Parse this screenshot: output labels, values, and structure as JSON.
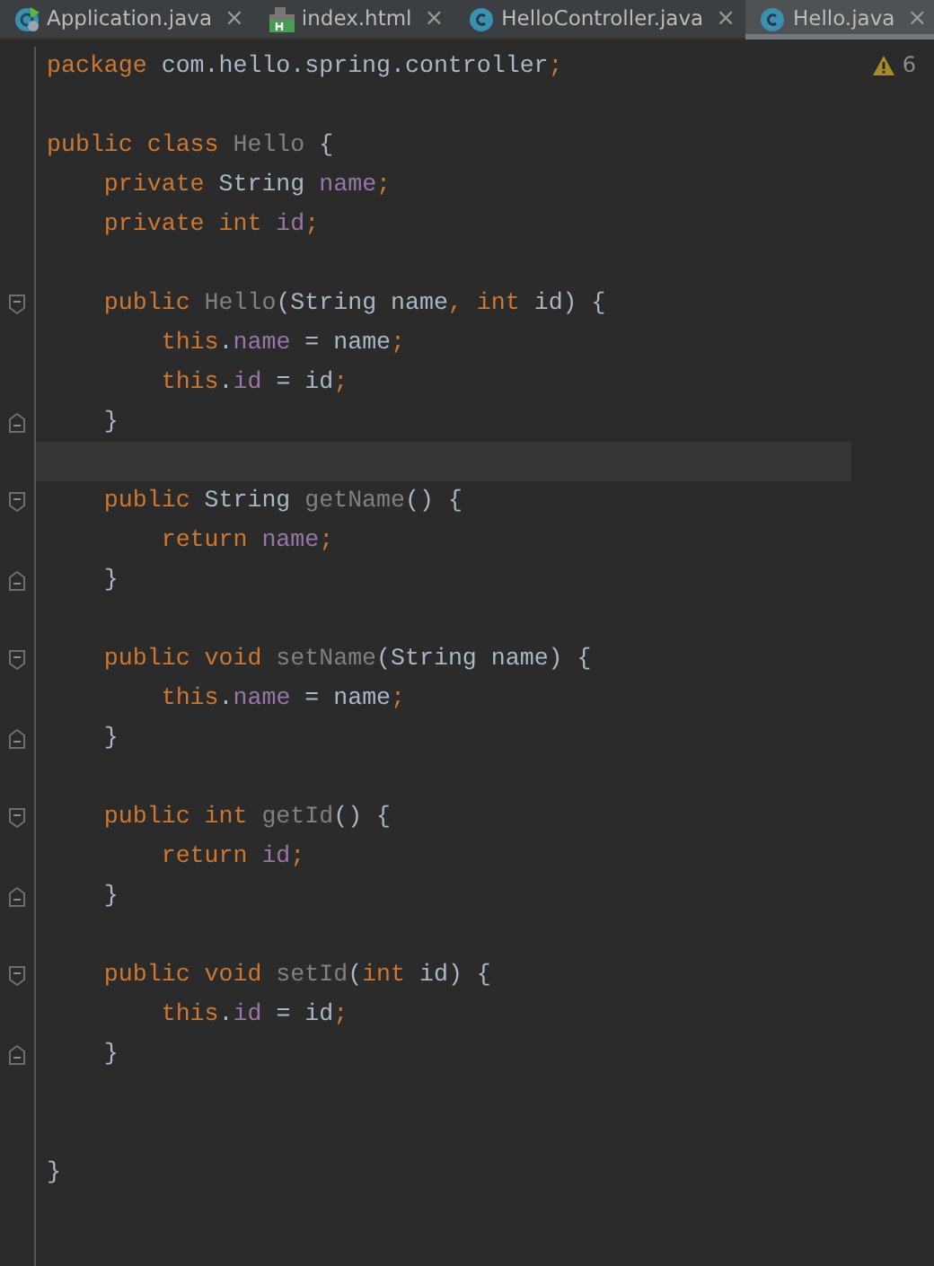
{
  "tabs": [
    {
      "label": "Application.java",
      "kind": "spring",
      "selected": false,
      "close": "×"
    },
    {
      "label": "index.html",
      "kind": "html",
      "selected": false,
      "close": "×"
    },
    {
      "label": "HelloController.java",
      "kind": "class",
      "selected": false,
      "close": "×"
    },
    {
      "label": "Hello.java",
      "kind": "class",
      "selected": true,
      "close": "×"
    }
  ],
  "warnings": {
    "count": "6"
  },
  "lines": [
    {
      "kind": "plain",
      "tokens": [
        {
          "text": "package",
          "kind": "kw"
        },
        {
          "text": " com.hello.spring.controller",
          "kind": "plain"
        },
        {
          "text": ";",
          "kind": "kw"
        }
      ]
    },
    {
      "kind": "blank"
    },
    {
      "kind": "plain",
      "tokens": [
        {
          "text": "public class",
          "kind": "kw"
        },
        {
          "text": " Hello",
          "kind": "unused"
        },
        {
          "text": " {",
          "kind": "plain"
        }
      ]
    },
    {
      "kind": "plain",
      "tokens": [
        {
          "text": "    private",
          "kind": "kw"
        },
        {
          "text": " String ",
          "kind": "plain"
        },
        {
          "text": "name",
          "kind": "field"
        },
        {
          "text": ";",
          "kind": "kw"
        }
      ]
    },
    {
      "kind": "plain",
      "tokens": [
        {
          "text": "    private int",
          "kind": "kw"
        },
        {
          "text": " id",
          "kind": "field"
        },
        {
          "text": ";",
          "kind": "kw"
        }
      ]
    },
    {
      "kind": "blank"
    },
    {
      "kind": "fold-start",
      "tokens": [
        {
          "text": "    public",
          "kind": "kw"
        },
        {
          "text": " Hello",
          "kind": "unused"
        },
        {
          "text": "(String name",
          "kind": "plain"
        },
        {
          "text": ", int",
          "kind": "kw"
        },
        {
          "text": " id) {",
          "kind": "plain"
        }
      ]
    },
    {
      "kind": "plain",
      "tokens": [
        {
          "text": "        this",
          "kind": "kw"
        },
        {
          "text": ".",
          "kind": "plain"
        },
        {
          "text": "name",
          "kind": "field"
        },
        {
          "text": " = name",
          "kind": "plain"
        },
        {
          "text": ";",
          "kind": "kw"
        }
      ]
    },
    {
      "kind": "plain",
      "tokens": [
        {
          "text": "        this",
          "kind": "kw"
        },
        {
          "text": ".",
          "kind": "plain"
        },
        {
          "text": "id",
          "kind": "field"
        },
        {
          "text": " = id",
          "kind": "plain"
        },
        {
          "text": ";",
          "kind": "kw"
        }
      ]
    },
    {
      "kind": "fold-end",
      "tokens": [
        {
          "text": "    }",
          "kind": "plain"
        }
      ]
    },
    {
      "kind": "current-line"
    },
    {
      "kind": "fold-start",
      "tokens": [
        {
          "text": "    public",
          "kind": "kw"
        },
        {
          "text": " String ",
          "kind": "plain"
        },
        {
          "text": "getName",
          "kind": "unused"
        },
        {
          "text": "() {",
          "kind": "plain"
        }
      ]
    },
    {
      "kind": "plain",
      "tokens": [
        {
          "text": "        return",
          "kind": "kw"
        },
        {
          "text": " name",
          "kind": "field"
        },
        {
          "text": ";",
          "kind": "kw"
        }
      ]
    },
    {
      "kind": "fold-end",
      "tokens": [
        {
          "text": "    }",
          "kind": "plain"
        }
      ]
    },
    {
      "kind": "blank"
    },
    {
      "kind": "fold-start",
      "tokens": [
        {
          "text": "    public void",
          "kind": "kw"
        },
        {
          "text": " setName",
          "kind": "unused"
        },
        {
          "text": "(String name) {",
          "kind": "plain"
        }
      ]
    },
    {
      "kind": "plain",
      "tokens": [
        {
          "text": "        this",
          "kind": "kw"
        },
        {
          "text": ".",
          "kind": "plain"
        },
        {
          "text": "name",
          "kind": "field"
        },
        {
          "text": " = name",
          "kind": "plain"
        },
        {
          "text": ";",
          "kind": "kw"
        }
      ]
    },
    {
      "kind": "fold-end",
      "tokens": [
        {
          "text": "    }",
          "kind": "plain"
        }
      ]
    },
    {
      "kind": "blank"
    },
    {
      "kind": "fold-start",
      "tokens": [
        {
          "text": "    public int",
          "kind": "kw"
        },
        {
          "text": " getId",
          "kind": "unused"
        },
        {
          "text": "() {",
          "kind": "plain"
        }
      ]
    },
    {
      "kind": "plain",
      "tokens": [
        {
          "text": "        return",
          "kind": "kw"
        },
        {
          "text": " id",
          "kind": "field"
        },
        {
          "text": ";",
          "kind": "kw"
        }
      ]
    },
    {
      "kind": "fold-end",
      "tokens": [
        {
          "text": "    }",
          "kind": "plain"
        }
      ]
    },
    {
      "kind": "blank"
    },
    {
      "kind": "fold-start",
      "tokens": [
        {
          "text": "    public void",
          "kind": "kw"
        },
        {
          "text": " setId",
          "kind": "unused"
        },
        {
          "text": "(",
          "kind": "plain"
        },
        {
          "text": "int",
          "kind": "kw"
        },
        {
          "text": " id) {",
          "kind": "plain"
        }
      ]
    },
    {
      "kind": "plain",
      "tokens": [
        {
          "text": "        this",
          "kind": "kw"
        },
        {
          "text": ".",
          "kind": "plain"
        },
        {
          "text": "id",
          "kind": "field"
        },
        {
          "text": " = id",
          "kind": "plain"
        },
        {
          "text": ";",
          "kind": "kw"
        }
      ]
    },
    {
      "kind": "fold-end",
      "tokens": [
        {
          "text": "    }",
          "kind": "plain"
        }
      ]
    },
    {
      "kind": "blank"
    },
    {
      "kind": "blank"
    },
    {
      "kind": "plain",
      "tokens": [
        {
          "text": "}",
          "kind": "plain"
        }
      ]
    }
  ]
}
